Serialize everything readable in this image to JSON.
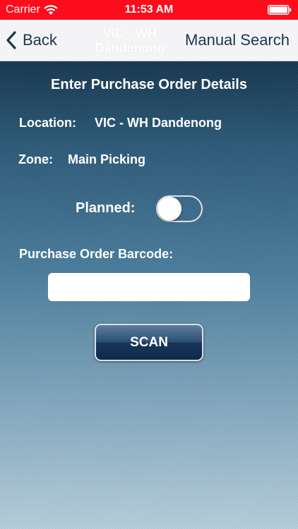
{
  "status_bar": {
    "carrier": "Carrier",
    "time": "11:53 AM",
    "background_color": "#fc0d1b",
    "icons": [
      "wifi-icon",
      "battery-icon"
    ]
  },
  "nav_bar": {
    "back_label": "Back",
    "title": "VIC - WH Dandenong",
    "right_action_label": "Manual Search",
    "icons": [
      "chevron-left-icon"
    ]
  },
  "form": {
    "heading": "Enter Purchase Order Details",
    "location_label": "Location:",
    "location_value": "VIC - WH Dandenong",
    "zone_label": "Zone:",
    "zone_value": "Main Picking",
    "planned_label": "Planned:",
    "planned_on": false,
    "barcode_label": "Purchase Order Barcode:",
    "barcode_value": "",
    "scan_label": "SCAN"
  },
  "colors": {
    "nav_text": "#1c3550",
    "scan_button": "#173558"
  }
}
